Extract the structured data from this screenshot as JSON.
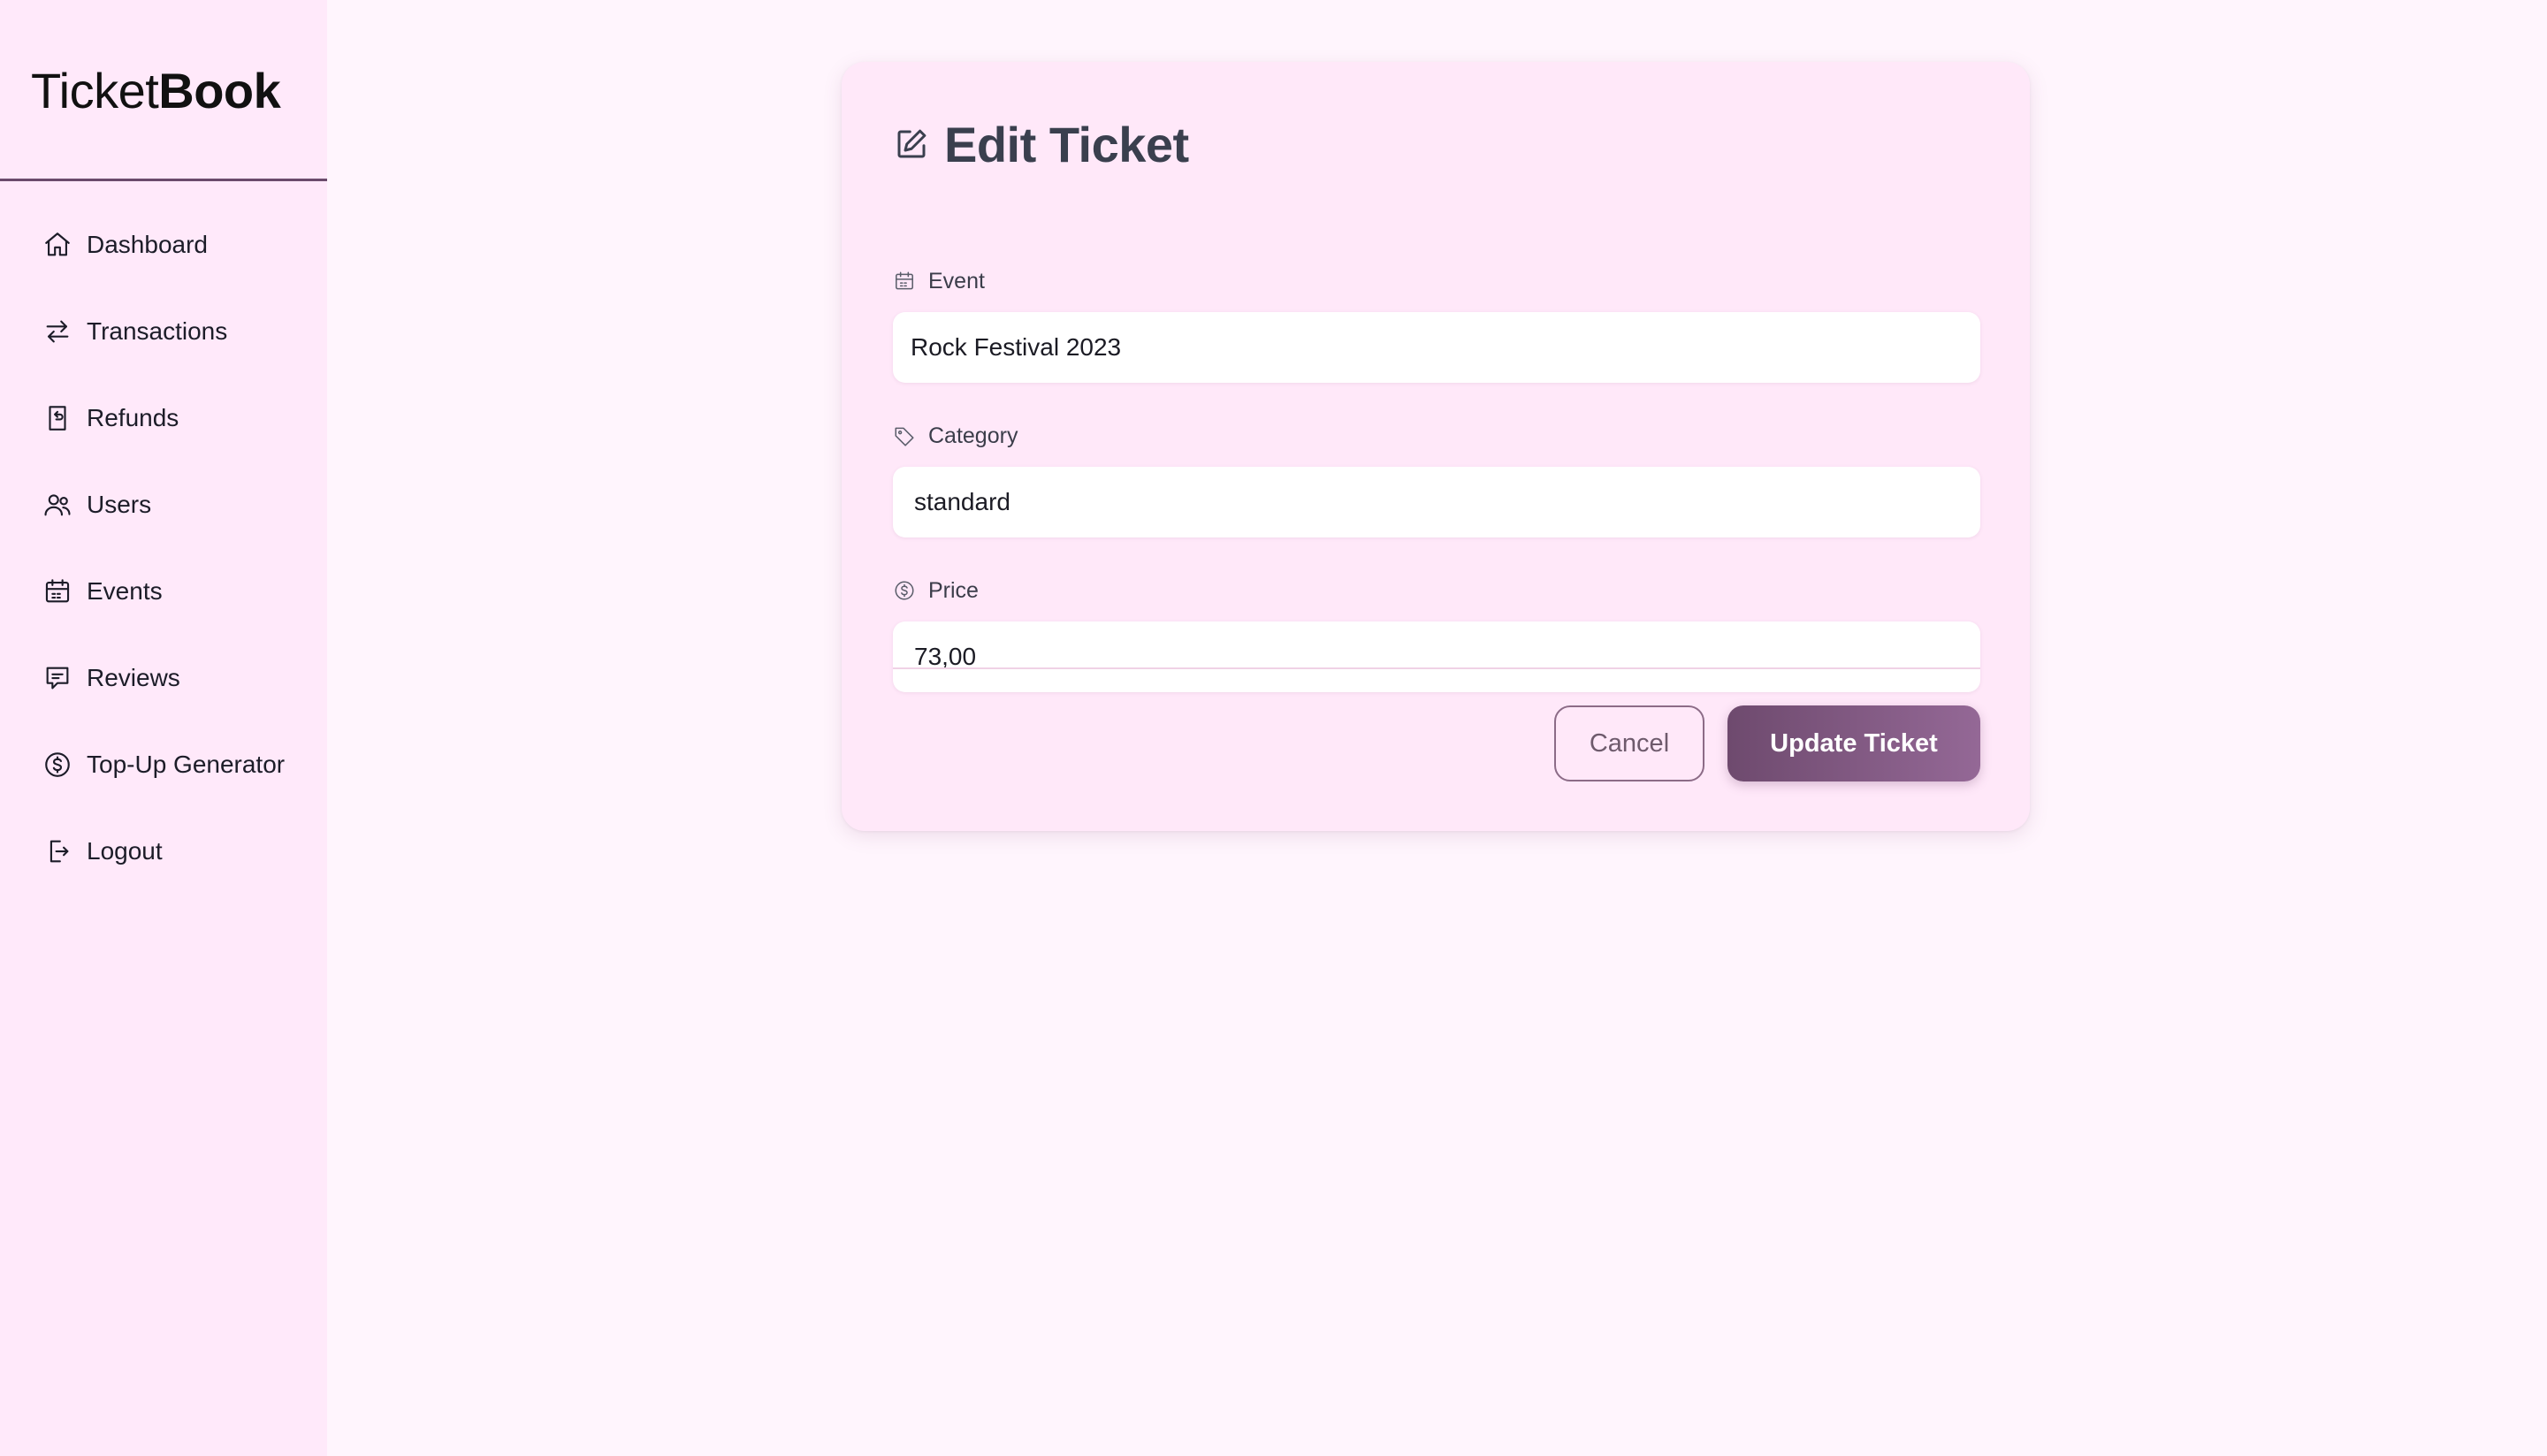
{
  "brand": {
    "name_light": "Ticket",
    "name_bold": "Book"
  },
  "sidebar": {
    "items": [
      {
        "label": "Dashboard",
        "icon": "home-icon"
      },
      {
        "label": "Transactions",
        "icon": "arrows-exchange-icon"
      },
      {
        "label": "Refunds",
        "icon": "receipt-refund-icon"
      },
      {
        "label": "Users",
        "icon": "users-icon"
      },
      {
        "label": "Events",
        "icon": "calendar-icon"
      },
      {
        "label": "Reviews",
        "icon": "message-icon"
      },
      {
        "label": "Top-Up Generator",
        "icon": "dollar-circle-icon"
      },
      {
        "label": "Logout",
        "icon": "logout-icon"
      }
    ]
  },
  "form": {
    "title": "Edit Ticket",
    "title_icon": "edit-icon",
    "event": {
      "label": "Event",
      "icon": "calendar-icon",
      "value": "Rock Festival 2023"
    },
    "category": {
      "label": "Category",
      "icon": "tag-icon",
      "value": "standard"
    },
    "price": {
      "label": "Price",
      "icon": "dollar-circle-icon",
      "value": "73,00"
    },
    "cancel_label": "Cancel",
    "submit_label": "Update Ticket"
  },
  "colors": {
    "page_bg": "#fff5fd",
    "sidebar_bg": "#ffe9fa",
    "card_bg": "#ffe8f9",
    "accent": "#7a527a",
    "accent_light": "#946896"
  }
}
